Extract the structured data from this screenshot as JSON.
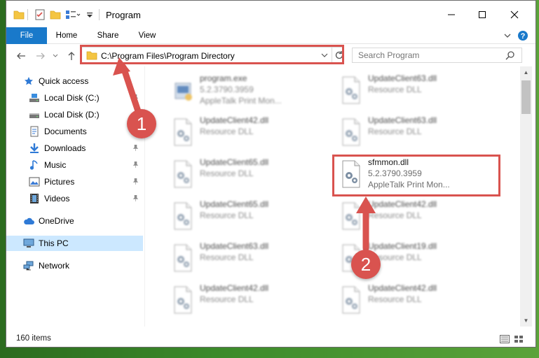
{
  "window": {
    "title": "Program"
  },
  "ribbon": {
    "tabs": [
      {
        "label": "File"
      },
      {
        "label": "Home"
      },
      {
        "label": "Share"
      },
      {
        "label": "View"
      }
    ]
  },
  "navigation": {
    "address_path": "C:\\Program Files\\Program Directory",
    "search_placeholder": "Search Program"
  },
  "sidebar": {
    "items": [
      {
        "label": "Quick access",
        "icon": "star-icon"
      },
      {
        "label": "Local Disk (C:)",
        "icon": "drive-icon"
      },
      {
        "label": "Local Disk (D:)",
        "icon": "drive-icon"
      },
      {
        "label": "Documents",
        "icon": "documents-icon"
      },
      {
        "label": "Downloads",
        "icon": "download-icon"
      },
      {
        "label": "Music",
        "icon": "music-icon"
      },
      {
        "label": "Pictures",
        "icon": "pictures-icon"
      },
      {
        "label": "Videos",
        "icon": "videos-icon"
      },
      {
        "label": "OneDrive",
        "icon": "cloud-icon"
      },
      {
        "label": "This PC",
        "icon": "computer-icon",
        "selected": true
      },
      {
        "label": "Network",
        "icon": "network-icon"
      }
    ]
  },
  "files": {
    "left_column": [
      {
        "name": "program.exe",
        "line1": "5.2.3790.3959",
        "line2": "AppleTalk Print Mon..."
      },
      {
        "name": "UpdateClient42.dll",
        "line1": "Resource DLL"
      },
      {
        "name": "UpdateClient65.dll",
        "line1": "Resource DLL"
      },
      {
        "name": "UpdateClient65.dll",
        "line1": "Resource DLL"
      },
      {
        "name": "UpdateClient63.dll",
        "line1": "Resource DLL"
      },
      {
        "name": "UpdateClient42.dll",
        "line1": "Resource DLL"
      }
    ],
    "right_column": [
      {
        "name": "UpdateClient63.dll",
        "line1": "Resource DLL"
      },
      {
        "name": "UpdateClient63.dll",
        "line1": "Resource DLL"
      },
      {
        "name": "sfmmon.dll",
        "line1": "5.2.3790.3959",
        "line2": "AppleTalk Print Mon..."
      },
      {
        "name": "UpdateClient42.dll",
        "line1": "Resource DLL"
      },
      {
        "name": "UpdateClient19.dll",
        "line1": "Resource DLL"
      },
      {
        "name": "UpdateClient42.dll",
        "line1": "Resource DLL"
      }
    ]
  },
  "status": {
    "item_count": "160 items"
  },
  "annotations": {
    "step1": "1",
    "step2": "2",
    "color": "#d9534f"
  },
  "colors": {
    "accent": "#1979ca",
    "selection": "#cce8ff"
  }
}
